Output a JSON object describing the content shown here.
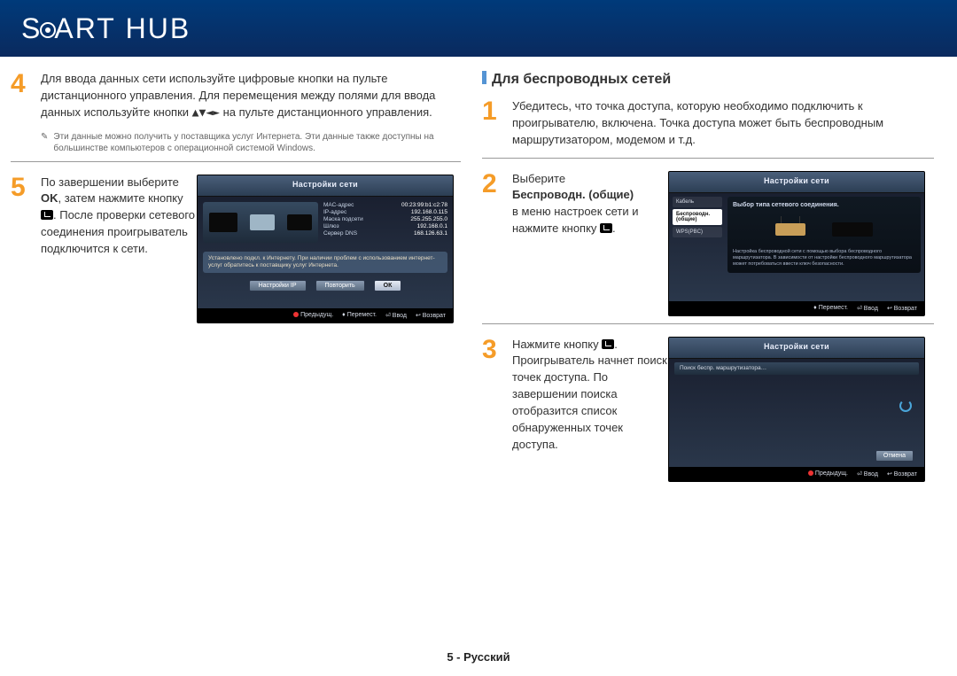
{
  "header": {
    "brand": "SMART HUB"
  },
  "left": {
    "step4": {
      "num": "4",
      "text_a": "Для ввода данных сети используйте цифровые кнопки на пульте дистанционного управления. Для перемещения между полями для ввода данных используйте кнопки ",
      "arrows": "▲▼◄►",
      "text_b": " на пульте дистанционного управления."
    },
    "note": "Эти данные можно получить у поставщика услуг Интернета. Эти данные также доступны на большинстве компьютеров с операционной системой Windows.",
    "step5": {
      "num": "5",
      "text_a": "По завершении выберите ",
      "ok": "OK",
      "text_b": ", затем нажмите кнопку ",
      "text_c": ". После проверки сетевого соединения проигрыватель подключится к сети."
    },
    "shot1": {
      "title": "Настройки сети",
      "kv": [
        {
          "k": "МАС-адрес",
          "v": "00:23:99:b1:c2:78"
        },
        {
          "k": "IP-адрес",
          "v": "192.168.0.115"
        },
        {
          "k": "Маска подсети",
          "v": "255.255.255.0"
        },
        {
          "k": "Шлюз",
          "v": "192.168.0.1"
        },
        {
          "k": "Сервер DNS",
          "v": "168.126.63.1"
        }
      ],
      "msg": "Установлено подкл. к Интернету. При наличии проблем с использованием интернет-услуг обратитесь к поставщику услуг Интернета.",
      "btns": {
        "ip": "Настройки IP",
        "retry": "Повторить",
        "ok": "ОК"
      },
      "nav": {
        "prev": "Предыдущ.",
        "move": "Перемест.",
        "enter": "Ввод",
        "ret": "Возврат"
      }
    }
  },
  "right": {
    "heading": "Для беспроводных сетей",
    "step1": {
      "num": "1",
      "text": "Убедитесь, что точка доступа, которую необходимо подключить к проигрывателю, включена. Точка доступа может быть беспроводным маршрутизатором, модемом и т.д."
    },
    "step2": {
      "num": "2",
      "text_a": "Выберите ",
      "bold": "Беспроводн. (общие)",
      "text_b": " в меню настроек сети и нажмите кнопку ",
      "text_c": "."
    },
    "shot2": {
      "title": "Настройки сети",
      "head": "Выбор типа сетевого соединения.",
      "items": [
        "Кабель",
        "Беспроводн.(общие)",
        "WPS(PBC)"
      ],
      "desc": "Настройка беспроводной сети с помощью выбора беспроводного маршрутизатора. В зависимости от настройки беспроводного маршрутизатора может потребоваться ввести ключ безопасности.",
      "nav": {
        "move": "Перемест.",
        "enter": "Ввод",
        "ret": "Возврат"
      }
    },
    "step3": {
      "num": "3",
      "text_a": "Нажмите кнопку ",
      "text_b": ". Проигрыватель начнет поиск точек доступа. По завершении поиска отобразится список обнаруженных точек доступа."
    },
    "shot3": {
      "title": "Настройки сети",
      "search": "Поиск беспр. маршрутизатора…",
      "cancel": "Отмена",
      "nav": {
        "prev": "Предыдущ.",
        "enter": "Ввод",
        "ret": "Возврат"
      }
    }
  },
  "footer": "5 - Русский"
}
